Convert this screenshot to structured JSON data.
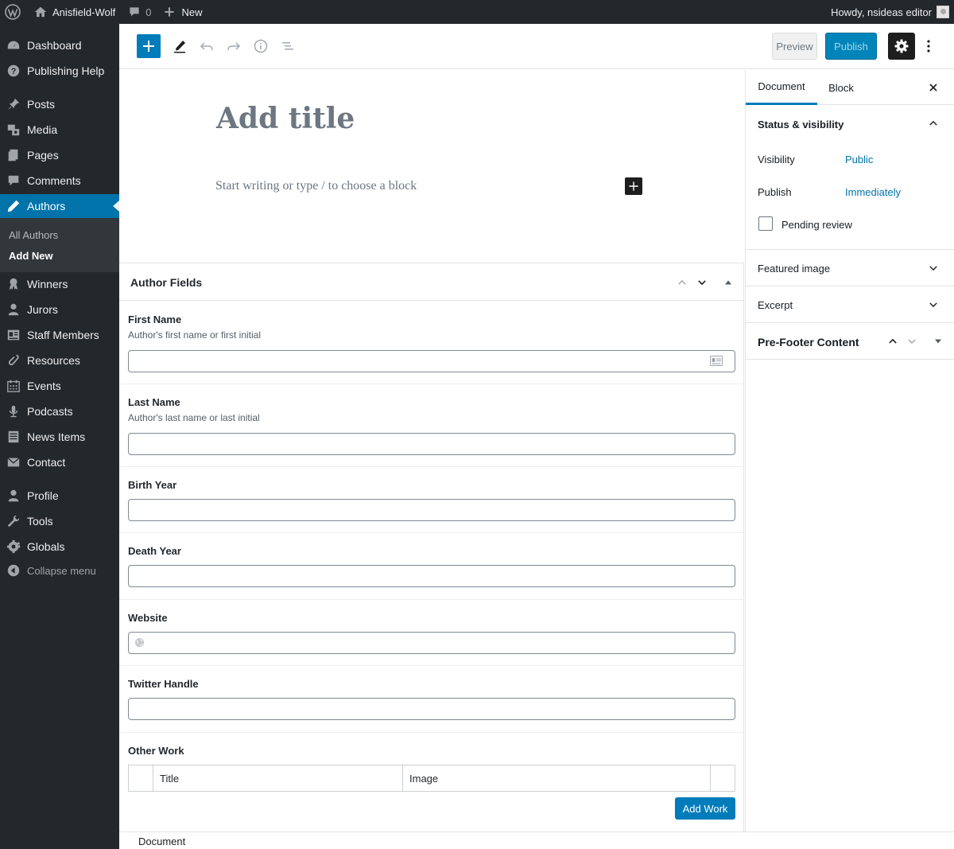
{
  "adminbar": {
    "site_name": "Anisfield-Wolf",
    "comments_count": "0",
    "new_label": "New",
    "howdy": "Howdy, nsideas editor"
  },
  "sidebar": {
    "items": [
      {
        "label": "Dashboard",
        "icon": "dashboard-icon"
      },
      {
        "label": "Publishing Help",
        "icon": "help-icon"
      },
      {
        "label": "Posts",
        "icon": "pin-icon"
      },
      {
        "label": "Media",
        "icon": "media-icon"
      },
      {
        "label": "Pages",
        "icon": "pages-icon"
      },
      {
        "label": "Comments",
        "icon": "comments-icon"
      },
      {
        "label": "Authors",
        "icon": "pen-icon"
      },
      {
        "label": "Winners",
        "icon": "award-icon"
      },
      {
        "label": "Jurors",
        "icon": "user-icon"
      },
      {
        "label": "Staff Members",
        "icon": "id-card-icon"
      },
      {
        "label": "Resources",
        "icon": "paperclip-icon"
      },
      {
        "label": "Events",
        "icon": "calendar-icon"
      },
      {
        "label": "Podcasts",
        "icon": "microphone-icon"
      },
      {
        "label": "News Items",
        "icon": "document-icon"
      },
      {
        "label": "Contact",
        "icon": "envelope-icon"
      },
      {
        "label": "Profile",
        "icon": "user-icon"
      },
      {
        "label": "Tools",
        "icon": "wrench-icon"
      },
      {
        "label": "Globals",
        "icon": "gear-icon"
      }
    ],
    "submenu": [
      "All Authors",
      "Add New"
    ],
    "collapse_label": "Collapse menu"
  },
  "toolbar": {
    "preview_label": "Preview",
    "publish_label": "Publish"
  },
  "editor": {
    "title_placeholder": "Add title",
    "block_placeholder": "Start writing or type / to choose a block"
  },
  "metabox": {
    "title": "Author Fields",
    "fields": {
      "first_name": {
        "label": "First Name",
        "desc": "Author's first name or first initial",
        "value": ""
      },
      "last_name": {
        "label": "Last Name",
        "desc": "Author's last name or last initial",
        "value": ""
      },
      "birth_year": {
        "label": "Birth Year",
        "value": ""
      },
      "death_year": {
        "label": "Death Year",
        "value": ""
      },
      "website": {
        "label": "Website",
        "value": ""
      },
      "twitter": {
        "label": "Twitter Handle",
        "value": ""
      }
    },
    "other_work": {
      "label": "Other Work",
      "columns": [
        "Title",
        "Image"
      ],
      "add_label": "Add Work"
    }
  },
  "breadcrumb": "Document",
  "settings": {
    "tabs": [
      "Document",
      "Block"
    ],
    "status_title": "Status & visibility",
    "visibility_label": "Visibility",
    "visibility_value": "Public",
    "publish_label": "Publish",
    "publish_value": "Immediately",
    "pending_label": "Pending review",
    "featured_image": "Featured image",
    "excerpt": "Excerpt",
    "prefooter": "Pre-Footer Content"
  },
  "colors": {
    "admin_dark": "#23282d",
    "accent": "#0073aa",
    "primary_button": "#007cba"
  }
}
